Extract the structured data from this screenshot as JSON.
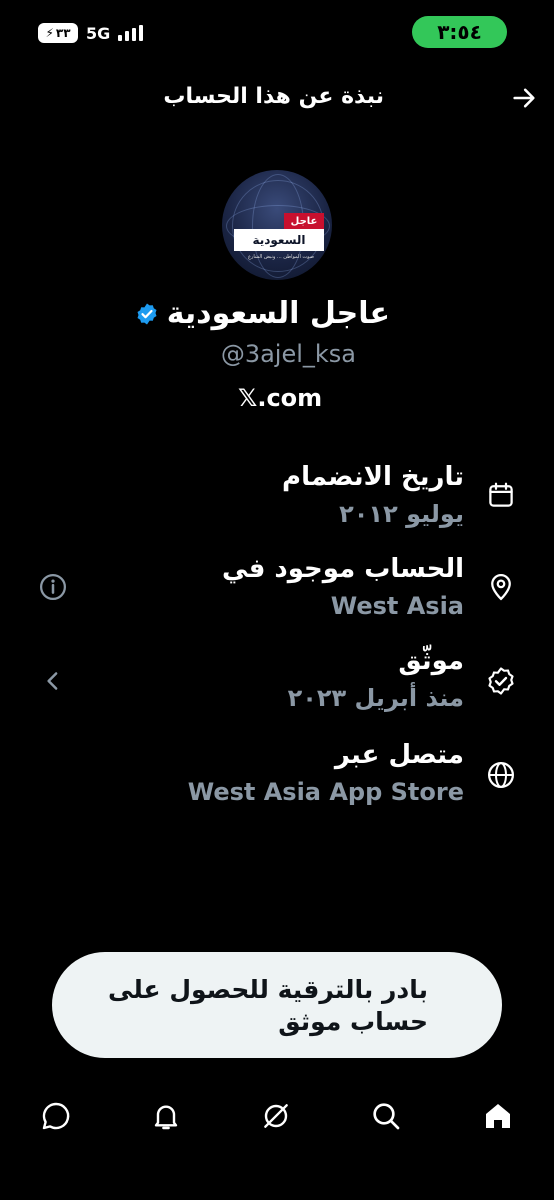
{
  "status_bar": {
    "time": "٣:٥٤",
    "network": "5G",
    "battery": "٣٣"
  },
  "header": {
    "title": "نبذة عن هذا الحساب",
    "back_icon": "arrow-right-icon"
  },
  "profile": {
    "display_name": "عاجل السعودية",
    "handle": "@3ajel_ksa",
    "website": "𝕏.com",
    "avatar": {
      "red_label": "عاجل",
      "white_label": "السعودية",
      "tagline": "صوت المواطن ... ونبض الشارع"
    }
  },
  "rows": [
    {
      "icon": "calendar-icon",
      "title": "تاريخ الانضمام",
      "value": "يوليو ٢٠١٢"
    },
    {
      "icon": "location-pin-icon",
      "title": "الحساب موجود في",
      "value": "West Asia",
      "side": "info-icon"
    },
    {
      "icon": "verified-icon",
      "title": "موثّق",
      "value": "منذ أبريل ٢٠٢٣",
      "side": "chevron-left-icon"
    },
    {
      "icon": "globe-icon",
      "title": "متصل عبر",
      "value": "West Asia App Store"
    }
  ],
  "upgrade": {
    "text": "بادر بالترقية للحصول على حساب موثق"
  },
  "bottom_nav": [
    "messages-icon",
    "notifications-icon",
    "grok-icon",
    "search-icon",
    "home-icon"
  ],
  "colors": {
    "background": "#000000",
    "accent_blue": "#1d9bf0",
    "muted": "#8b98a5",
    "time_green": "#33c759"
  }
}
